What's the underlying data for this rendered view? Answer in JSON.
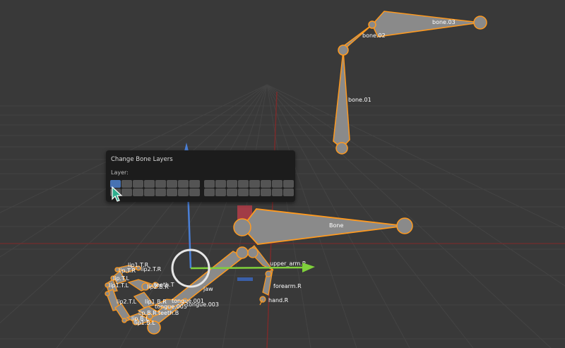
{
  "panel": {
    "title": "Change Bone Layers",
    "layer_label": "Layer:",
    "groups": [
      {
        "name": "group-1",
        "active_index": 0
      },
      {
        "name": "group-2",
        "active_index": -1
      }
    ]
  },
  "bones": {
    "bone_01": "bone.01",
    "bone_02": "bone.02",
    "bone_03": "bone.03",
    "bone": "Bone",
    "upper_arm": "upper_arm.R",
    "forearm": "forearm.R",
    "hand": "hand.R",
    "jaw": "jaw",
    "lip1_t_r": "lip1.T.R",
    "lip_t_r": "lip.T.R",
    "lip2_t_r": "lip2.T.R",
    "lip_t_l": "lip.T.L",
    "lip1_t_l": "lip1.T.L",
    "lip2_b_r": "lip2.B.R",
    "teeth_t": "teeth.T",
    "lip2_t_l": "lip2.T.L",
    "lip1_b_r": "lip1.B.R",
    "tongue_001": "tongue.001",
    "tongue_003": "tongue.003",
    "tongue_005": "tongue.005",
    "lip_b_r": "lip.B.R",
    "teeth_b": "teeth.B",
    "lip_b_l": "lip.B.L",
    "lip1_b_l": "lip1.B.L"
  },
  "colors": {
    "background": "#393939",
    "grid": "#464646",
    "selection": "#ff9a1f",
    "bone_fill": "#8a8a8a",
    "axis_x": "#7a2b2b",
    "axis_z": "#2e4e8a",
    "gizmo_z": "#4a7fd6",
    "gizmo_y": "#7fd13b",
    "layer_active": "#4772b3"
  },
  "cursor": "pointer-cursor-icon"
}
